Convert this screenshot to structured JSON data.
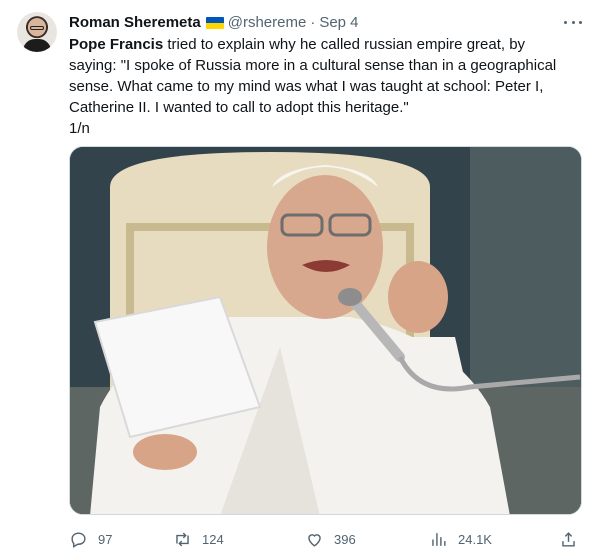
{
  "tweet": {
    "author_name": "Roman Sheremeta",
    "handle": "@rshereme",
    "separator": "·",
    "date": "Sep 4",
    "text_lines": [
      {
        "bold": "Pope Francis",
        "rest": " tried to explain why he called russian empire great, by"
      },
      {
        "bold": "",
        "rest": "saying: \"I spoke of Russia more in a cultural sense than in a geographical"
      },
      {
        "bold": "",
        "rest": "sense. What came to my mind was what I was taught at school: Peter I,"
      },
      {
        "bold": "",
        "rest": "Catherine II. I wanted to call to adopt this heritage.\""
      },
      {
        "bold": "",
        "rest": "1/n"
      }
    ]
  },
  "actions": {
    "replies": "97",
    "retweets": "124",
    "likes": "396",
    "views": "24.1K"
  },
  "icons": {
    "reply": "reply-icon",
    "retweet": "retweet-icon",
    "like": "heart-icon",
    "views": "views-icon",
    "share": "share-icon",
    "more": "more-icon",
    "flag": "ukraine-flag-icon"
  },
  "colors": {
    "text": "#0f1419",
    "secondary": "#536471",
    "flag_blue": "#0057b7",
    "flag_yellow": "#ffd700"
  }
}
